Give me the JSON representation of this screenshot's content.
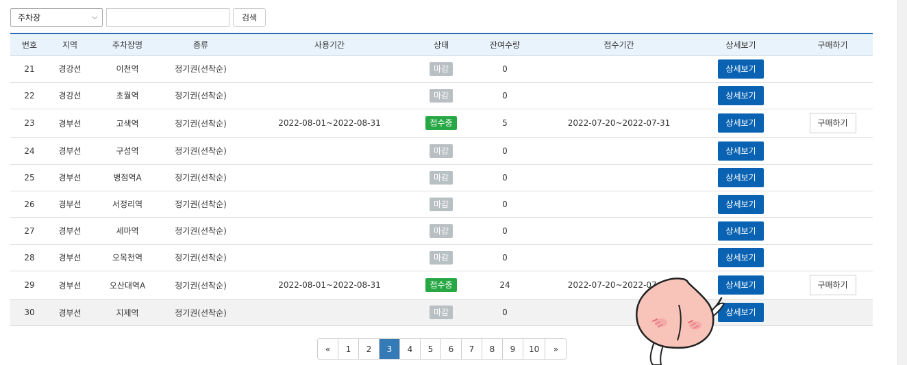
{
  "search": {
    "select_value": "주차장",
    "input_value": "",
    "button_label": "검색"
  },
  "table": {
    "headers": [
      "번호",
      "지역",
      "주차장명",
      "종류",
      "사용기간",
      "상태",
      "잔여수량",
      "접수기간",
      "상세보기",
      "구매하기"
    ],
    "rows": [
      {
        "no": "21",
        "region": "경강선",
        "name": "이천역",
        "type": "정기권(선착순)",
        "period": "",
        "status": "마감",
        "remaining": "0",
        "reception": "",
        "detail": "상세보기",
        "buy": ""
      },
      {
        "no": "22",
        "region": "경강선",
        "name": "초월역",
        "type": "정기권(선착순)",
        "period": "",
        "status": "마감",
        "remaining": "0",
        "reception": "",
        "detail": "상세보기",
        "buy": ""
      },
      {
        "no": "23",
        "region": "경부선",
        "name": "고색역",
        "type": "정기권(선착순)",
        "period": "2022-08-01~2022-08-31",
        "status": "접수중",
        "remaining": "5",
        "reception": "2022-07-20~2022-07-31",
        "detail": "상세보기",
        "buy": "구매하기"
      },
      {
        "no": "24",
        "region": "경부선",
        "name": "구성역",
        "type": "정기권(선착순)",
        "period": "",
        "status": "마감",
        "remaining": "0",
        "reception": "",
        "detail": "상세보기",
        "buy": ""
      },
      {
        "no": "25",
        "region": "경부선",
        "name": "병점역A",
        "type": "정기권(선착순)",
        "period": "",
        "status": "마감",
        "remaining": "0",
        "reception": "",
        "detail": "상세보기",
        "buy": ""
      },
      {
        "no": "26",
        "region": "경부선",
        "name": "서정리역",
        "type": "정기권(선착순)",
        "period": "",
        "status": "마감",
        "remaining": "0",
        "reception": "",
        "detail": "상세보기",
        "buy": ""
      },
      {
        "no": "27",
        "region": "경부선",
        "name": "세마역",
        "type": "정기권(선착순)",
        "period": "",
        "status": "마감",
        "remaining": "0",
        "reception": "",
        "detail": "상세보기",
        "buy": ""
      },
      {
        "no": "28",
        "region": "경부선",
        "name": "오목천역",
        "type": "정기권(선착순)",
        "period": "",
        "status": "마감",
        "remaining": "0",
        "reception": "",
        "detail": "상세보기",
        "buy": ""
      },
      {
        "no": "29",
        "region": "경부선",
        "name": "오산대역A",
        "type": "정기권(선착순)",
        "period": "2022-08-01~2022-08-31",
        "status": "접수중",
        "remaining": "24",
        "reception": "2022-07-20~2022-07-31",
        "detail": "상세보기",
        "buy": "구매하기"
      },
      {
        "no": "30",
        "region": "경부선",
        "name": "지제역",
        "type": "정기권(선착순)",
        "period": "",
        "status": "마감",
        "remaining": "0",
        "reception": "",
        "detail": "상세보기",
        "buy": ""
      }
    ]
  },
  "pagination": {
    "prev": "«",
    "next": "»",
    "pages": [
      "1",
      "2",
      "3",
      "4",
      "5",
      "6",
      "7",
      "8",
      "9",
      "10"
    ],
    "active": "3"
  },
  "icons": {
    "select_arrow": "chevron-down-icon",
    "mascot": "peach-character-sticker"
  },
  "colors": {
    "header_border": "#2a6ab5",
    "header_bg": "#e9f3fb",
    "detail_button": "#0a63b2",
    "status_open": "#27a844",
    "status_closed": "#b9c0c4",
    "page_active": "#337ab7"
  }
}
